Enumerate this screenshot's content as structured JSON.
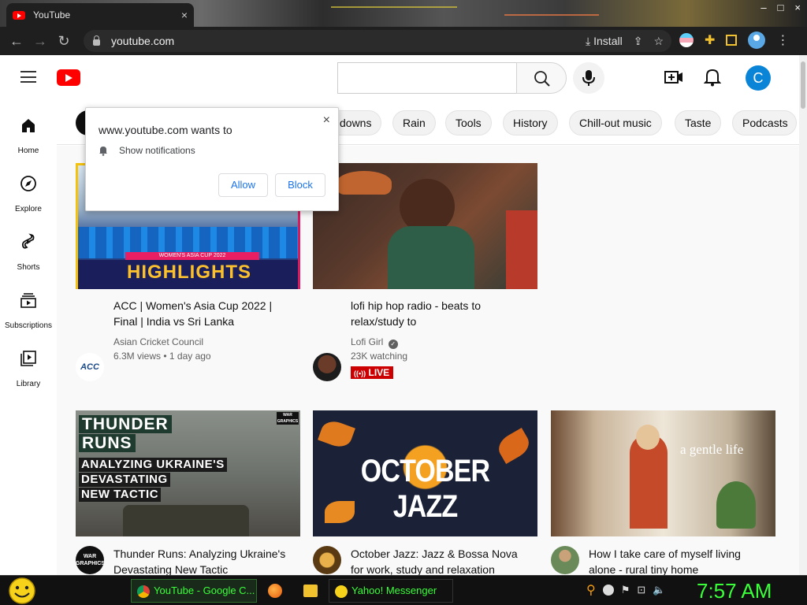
{
  "browser": {
    "tab_title": "YouTube",
    "tab_close": "×",
    "url": "youtube.com",
    "install_label": "Install",
    "win_controls": [
      "–",
      "□",
      "×"
    ]
  },
  "popup": {
    "title": "www.youtube.com wants to",
    "permission": "Show notifications",
    "allow": "Allow",
    "block": "Block",
    "close": "×"
  },
  "masthead": {
    "avatar_letter": "C"
  },
  "chips": [
    "downs",
    "Rain",
    "Tools",
    "History",
    "Chill-out music",
    "Taste",
    "Podcasts"
  ],
  "sidebar": [
    {
      "label": "Home",
      "icon": "home-icon"
    },
    {
      "label": "Explore",
      "icon": "compass-icon"
    },
    {
      "label": "Shorts",
      "icon": "shorts-icon"
    },
    {
      "label": "Subscriptions",
      "icon": "subscriptions-icon"
    },
    {
      "label": "Library",
      "icon": "library-icon"
    }
  ],
  "videos": [
    {
      "title": "ACC | Women's Asia Cup 2022 | Final | India vs Sri Lanka",
      "channel": "Asian Cricket Council",
      "meta": "6.3M views • 1 day ago",
      "thumb_text": "HIGHLIGHTS",
      "thumb_sub": "WOMEN'S ASIA CUP 2022",
      "avatar_text": "ACC"
    },
    {
      "title": "lofi hip hop radio - beats to relax/study to",
      "channel": "Lofi Girl",
      "meta": "23K watching",
      "badge": "LIVE"
    },
    {
      "title": "Thunder Runs: Analyzing Ukraine's Devastating New Tactic",
      "thumb_lines": [
        "THUNDER",
        "RUNS",
        "ANALYZING UKRAINE'S",
        "DEVASTATING",
        "NEW TACTIC"
      ],
      "thumb_badge": "WAR GRAPHICS",
      "avatar_text": "WAR GRAPHICS"
    },
    {
      "title": "October Jazz: Jazz & Bossa Nova for work, study and relaxation",
      "thumb_text": "OCTOBER JAZZ"
    },
    {
      "title": "How I take care of myself living alone - rural tiny home",
      "thumb_text": "a gentle life"
    }
  ],
  "taskbar": {
    "tasks": [
      "YouTube - Google C...",
      "Yahoo! Messenger"
    ],
    "clock": "7:57 AM"
  },
  "colors": {
    "youtube_red": "#ff0000",
    "avatar_blue": "#0a84d6",
    "live_red": "#cc0000",
    "taskbar_green": "#39ff39"
  }
}
